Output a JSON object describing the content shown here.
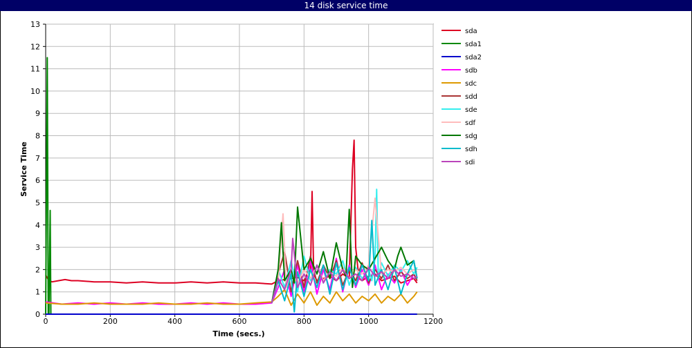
{
  "window": {
    "title": "14 disk service time"
  },
  "chart_data": {
    "type": "line",
    "title": "14 disk service time",
    "xlabel": "Time (secs.)",
    "ylabel": "Service Time",
    "xlim": [
      0,
      1200
    ],
    "ylim": [
      0,
      13
    ],
    "xticks": [
      0,
      200,
      400,
      600,
      800,
      1000,
      1200
    ],
    "yticks": [
      0,
      1,
      2,
      3,
      4,
      5,
      6,
      7,
      8,
      9,
      10,
      11,
      12,
      13
    ],
    "grid": true,
    "legend_position": "right",
    "series": [
      {
        "name": "sda",
        "color": "#dd0022",
        "x": [
          0,
          10,
          20,
          40,
          60,
          80,
          100,
          150,
          200,
          250,
          300,
          350,
          400,
          450,
          500,
          550,
          600,
          650,
          700,
          720,
          740,
          760,
          780,
          800,
          820,
          825,
          830,
          840,
          860,
          880,
          900,
          920,
          940,
          950,
          955,
          960,
          970,
          980,
          1000,
          1020,
          1040,
          1060,
          1080,
          1100,
          1120,
          1140,
          1150
        ],
        "y": [
          1.75,
          1.5,
          1.45,
          1.5,
          1.55,
          1.5,
          1.5,
          1.45,
          1.45,
          1.4,
          1.45,
          1.4,
          1.4,
          1.45,
          1.4,
          1.45,
          1.4,
          1.4,
          1.35,
          1.5,
          1.55,
          1.6,
          1.65,
          1.5,
          2.0,
          5.5,
          1.8,
          1.5,
          1.6,
          1.7,
          1.5,
          1.8,
          1.6,
          6.5,
          7.8,
          3.0,
          1.6,
          1.5,
          1.7,
          1.8,
          1.5,
          1.6,
          1.7,
          1.4,
          1.5,
          1.6,
          1.4
        ]
      },
      {
        "name": "sda1",
        "color": "#008800",
        "x": [
          0,
          5,
          8,
          10,
          14,
          16,
          20,
          1150
        ],
        "y": [
          0,
          11.5,
          0,
          0,
          4.65,
          0,
          0,
          0
        ]
      },
      {
        "name": "sda2",
        "color": "#0000cc",
        "x": [
          0,
          1150
        ],
        "y": [
          0,
          0
        ]
      },
      {
        "name": "sdb",
        "color": "#ff00ff",
        "x": [
          0,
          50,
          100,
          150,
          200,
          250,
          300,
          350,
          400,
          450,
          500,
          550,
          600,
          650,
          700,
          720,
          740,
          760,
          780,
          800,
          820,
          840,
          860,
          880,
          900,
          920,
          940,
          960,
          980,
          1000,
          1020,
          1040,
          1060,
          1080,
          1100,
          1120,
          1140,
          1150
        ],
        "y": [
          0.55,
          0.45,
          0.5,
          0.45,
          0.5,
          0.45,
          0.5,
          0.45,
          0.45,
          0.5,
          0.45,
          0.5,
          0.45,
          0.45,
          0.5,
          1.2,
          2.0,
          0.8,
          2.2,
          1.0,
          2.4,
          0.9,
          2.0,
          1.1,
          2.5,
          1.0,
          2.2,
          1.2,
          2.0,
          1.3,
          2.2,
          1.1,
          1.8,
          1.4,
          2.0,
          1.3,
          1.8,
          1.5
        ]
      },
      {
        "name": "sdc",
        "color": "#dd9900",
        "x": [
          0,
          50,
          100,
          150,
          200,
          250,
          300,
          350,
          400,
          450,
          500,
          550,
          600,
          650,
          700,
          720,
          740,
          760,
          780,
          800,
          820,
          840,
          860,
          880,
          900,
          920,
          940,
          960,
          980,
          1000,
          1020,
          1040,
          1060,
          1080,
          1100,
          1120,
          1140,
          1150
        ],
        "y": [
          0.5,
          0.45,
          0.45,
          0.5,
          0.45,
          0.45,
          0.45,
          0.5,
          0.45,
          0.45,
          0.5,
          0.45,
          0.45,
          0.5,
          0.55,
          0.8,
          1.1,
          0.4,
          0.9,
          0.5,
          1.0,
          0.4,
          0.8,
          0.5,
          1.0,
          0.6,
          0.9,
          0.5,
          0.8,
          0.6,
          0.9,
          0.5,
          0.8,
          0.6,
          0.9,
          0.5,
          0.8,
          1.0
        ]
      },
      {
        "name": "sdd",
        "color": "#aa3333",
        "x": [
          700,
          720,
          740,
          760,
          780,
          800,
          820,
          840,
          860,
          880,
          900,
          920,
          940,
          960,
          980,
          1000,
          1020,
          1040,
          1060,
          1080,
          1100,
          1120,
          1140,
          1150
        ],
        "y": [
          0.5,
          1.8,
          2.8,
          1.0,
          2.4,
          1.2,
          2.6,
          1.4,
          2.2,
          1.6,
          2.4,
          1.3,
          2.0,
          1.5,
          2.3,
          1.4,
          2.0,
          1.6,
          2.2,
          1.5,
          1.9,
          1.6,
          1.8,
          1.5
        ]
      },
      {
        "name": "sde",
        "color": "#33eeee",
        "x": [
          700,
          720,
          740,
          760,
          780,
          800,
          820,
          840,
          860,
          880,
          900,
          920,
          940,
          960,
          980,
          1000,
          1010,
          1020,
          1025,
          1030,
          1040,
          1060,
          1080,
          1100,
          1120,
          1140,
          1150
        ],
        "y": [
          0.5,
          2.0,
          1.2,
          2.4,
          1.0,
          2.6,
          1.5,
          2.2,
          1.4,
          2.0,
          1.8,
          2.4,
          1.3,
          2.1,
          1.6,
          2.0,
          1.5,
          2.5,
          5.6,
          1.6,
          2.3,
          1.7,
          2.2,
          1.9,
          2.4,
          1.8,
          2.1
        ]
      },
      {
        "name": "sdf",
        "color": "#ffbbbb",
        "x": [
          700,
          720,
          735,
          745,
          760,
          780,
          800,
          820,
          840,
          860,
          880,
          900,
          920,
          940,
          960,
          980,
          1000,
          1020,
          1040,
          1060,
          1080,
          1100,
          1120,
          1140,
          1150
        ],
        "y": [
          0.5,
          1.5,
          4.5,
          1.2,
          1.8,
          1.4,
          2.0,
          1.6,
          2.2,
          1.5,
          1.9,
          1.7,
          2.1,
          1.6,
          2.0,
          1.8,
          2.2,
          5.2,
          1.8,
          2.0,
          1.9,
          2.1,
          1.8,
          2.0,
          1.9
        ]
      },
      {
        "name": "sdg",
        "color": "#007700",
        "x": [
          700,
          720,
          730,
          740,
          760,
          770,
          780,
          800,
          820,
          840,
          860,
          880,
          900,
          920,
          930,
          940,
          950,
          960,
          980,
          1000,
          1020,
          1040,
          1060,
          1080,
          1090,
          1100,
          1120,
          1140,
          1150
        ],
        "y": [
          0.5,
          2.0,
          4.1,
          1.5,
          2.0,
          1.4,
          4.8,
          2.0,
          2.5,
          1.8,
          2.8,
          1.6,
          3.2,
          2.0,
          1.7,
          4.7,
          1.2,
          2.6,
          2.2,
          2.0,
          2.5,
          3.0,
          2.4,
          2.0,
          2.6,
          3.0,
          2.2,
          2.4,
          1.6
        ]
      },
      {
        "name": "sdh",
        "color": "#00bbcc",
        "x": [
          700,
          720,
          740,
          760,
          770,
          780,
          800,
          820,
          840,
          860,
          880,
          900,
          920,
          940,
          960,
          980,
          1000,
          1010,
          1020,
          1040,
          1060,
          1080,
          1100,
          1120,
          1140,
          1150
        ],
        "y": [
          0.5,
          1.5,
          0.6,
          1.8,
          0.1,
          1.9,
          0.8,
          2.0,
          1.2,
          2.2,
          0.9,
          2.3,
          1.1,
          2.1,
          1.3,
          2.2,
          1.5,
          4.2,
          1.3,
          2.0,
          1.1,
          2.1,
          0.9,
          1.8,
          2.4,
          1.6
        ]
      },
      {
        "name": "sdi",
        "color": "#bb44bb",
        "x": [
          700,
          720,
          740,
          760,
          765,
          780,
          800,
          820,
          840,
          860,
          880,
          900,
          920,
          940,
          960,
          980,
          1000,
          1020,
          1040,
          1060,
          1080,
          1100,
          1120,
          1140,
          1150
        ],
        "y": [
          0.5,
          1.6,
          1.1,
          2.0,
          3.4,
          1.2,
          1.8,
          1.3,
          2.2,
          1.4,
          1.9,
          1.5,
          2.0,
          1.6,
          1.8,
          1.5,
          2.1,
          1.7,
          1.9,
          1.6,
          2.0,
          1.7,
          1.8,
          1.6,
          1.7
        ]
      }
    ]
  }
}
